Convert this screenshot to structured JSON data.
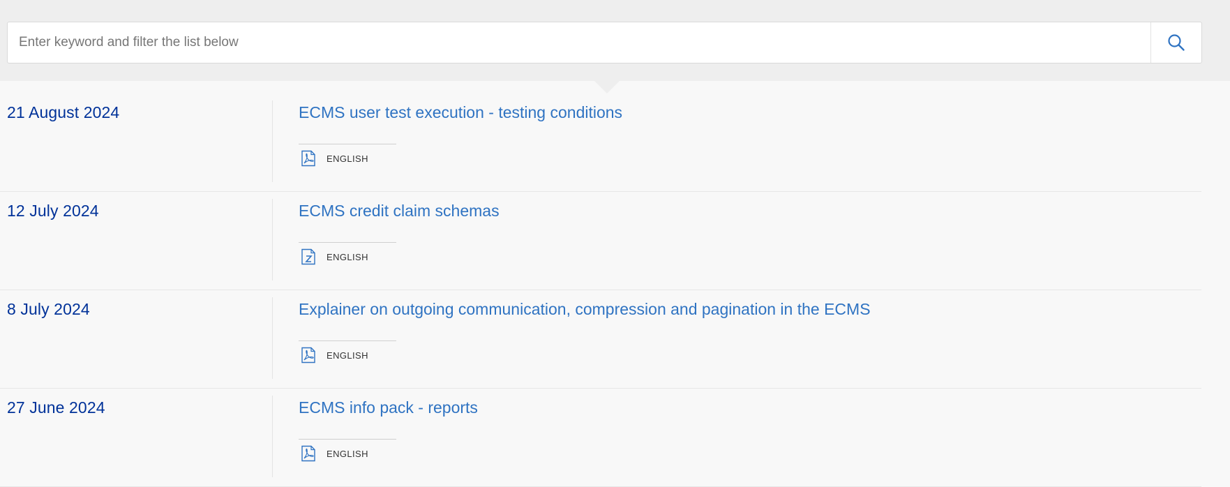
{
  "search": {
    "placeholder": "Enter keyword and filter the list below",
    "value": "",
    "button_icon": "search-icon"
  },
  "publications": [
    {
      "date": "21 August 2024",
      "title": "ECMS user test execution - testing conditions",
      "file_icon": "pdf-icon",
      "language": "ENGLISH"
    },
    {
      "date": "12 July 2024",
      "title": "ECMS credit claim schemas",
      "file_icon": "zip-icon",
      "language": "ENGLISH"
    },
    {
      "date": "8 July 2024",
      "title": "Explainer on outgoing communication, compression and pagination in the ECMS",
      "file_icon": "pdf-icon",
      "language": "ENGLISH"
    },
    {
      "date": "27 June 2024",
      "title": "ECMS info pack - reports",
      "file_icon": "pdf-icon",
      "language": "ENGLISH"
    }
  ],
  "colors": {
    "date": "#003299",
    "title_link": "#2f73c2",
    "top_band": "#eeeeee",
    "list_background": "#f8f8f8"
  }
}
